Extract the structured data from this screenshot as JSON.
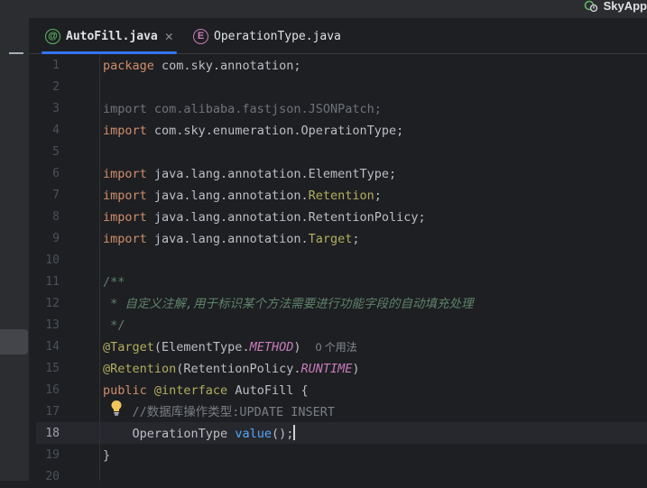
{
  "titlebar": {
    "run_config": "SkyApp"
  },
  "tabs": [
    {
      "label": "AutoFill.java",
      "icon": "@",
      "active": true
    },
    {
      "label": "OperationType.java",
      "icon": "E",
      "active": false
    }
  ],
  "editor": {
    "current_line": 18,
    "line_numbers": [
      "1",
      "2",
      "3",
      "4",
      "5",
      "6",
      "7",
      "8",
      "9",
      "10",
      "11",
      "12",
      "13",
      "14",
      "15",
      "16",
      "17",
      "18",
      "19",
      "20"
    ],
    "code": {
      "l1_kw": "package",
      "l1_rest": " com.sky.annotation;",
      "l3": "import com.alibaba.fastjson.JSONPatch;",
      "l4_kw": "import",
      "l4_rest": " com.sky.enumeration.OperationType;",
      "l6_kw": "import",
      "l6_rest": " java.lang.annotation.ElementType;",
      "l7_kw": "import",
      "l7_a": " java.lang.annotation.",
      "l7_b": "Retention",
      "l7_c": ";",
      "l8_kw": "import",
      "l8_rest": " java.lang.annotation.RetentionPolicy;",
      "l9_kw": "import",
      "l9_a": " java.lang.annotation.",
      "l9_b": "Target",
      "l9_c": ";",
      "l11": "/**",
      "l12": " * 自定义注解,用于标识某个方法需要进行功能字段的自动填充处理",
      "l13": " */",
      "l14_anno": "@Target",
      "l14_a": "(ElementType.",
      "l14_b": "METHOD",
      "l14_c": ")",
      "l14_hint": "0 个用法",
      "l15_anno": "@Retention",
      "l15_a": "(RetentionPolicy.",
      "l15_b": "RUNTIME",
      "l15_c": ")",
      "l16_kw": "public",
      "l16_anno": " @interface",
      "l16_name": " AutoFill",
      "l16_brace": " {",
      "l17": "    //数据库操作类型:UPDATE INSERT",
      "l18_type": "    OperationType ",
      "l18_meth": "value",
      "l18_end": "();",
      "l19": "}"
    }
  },
  "colors": {
    "accent": "#3574f0",
    "keyword": "#cf8e6d",
    "annotation": "#b3ae60",
    "doc_comment": "#5f826b",
    "method": "#56a8f5"
  }
}
